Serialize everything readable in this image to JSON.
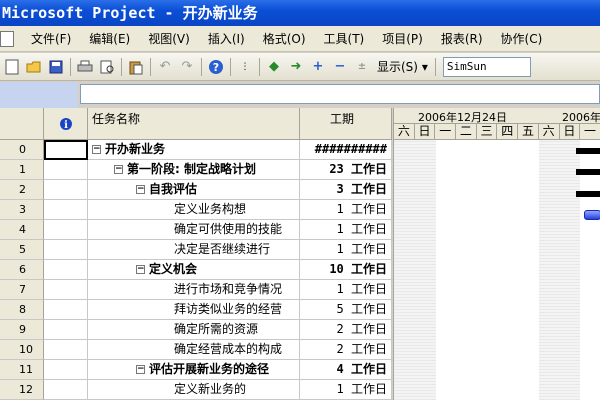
{
  "window": {
    "title": "Microsoft Project - 开办新业务"
  },
  "menu": [
    "文件(F)",
    "编辑(E)",
    "视图(V)",
    "插入(I)",
    "格式(O)",
    "工具(T)",
    "项目(P)",
    "报表(R)",
    "协作(C)"
  ],
  "toolbar": {
    "show_label": "显示(S)",
    "show_arrow": "▾",
    "font": "SimSun"
  },
  "grid": {
    "headers": {
      "info": "i",
      "name": "任务名称",
      "duration": "工期"
    },
    "rows": [
      {
        "id": "0",
        "name": "开办新业务",
        "duration": "##########",
        "bold": true,
        "indent": 0,
        "toggle": "−"
      },
      {
        "id": "1",
        "name": "第一阶段: 制定战略计划",
        "duration": "23 工作日",
        "bold": true,
        "indent": 1,
        "toggle": "−"
      },
      {
        "id": "2",
        "name": "自我评估",
        "duration": "3 工作日",
        "bold": true,
        "indent": 2,
        "toggle": "−"
      },
      {
        "id": "3",
        "name": "定义业务构想",
        "duration": "1 工作日",
        "bold": false,
        "indent": 3,
        "toggle": ""
      },
      {
        "id": "4",
        "name": "确定可供使用的技能",
        "duration": "1 工作日",
        "bold": false,
        "indent": 3,
        "toggle": ""
      },
      {
        "id": "5",
        "name": "决定是否继续进行",
        "duration": "1 工作日",
        "bold": false,
        "indent": 3,
        "toggle": ""
      },
      {
        "id": "6",
        "name": "定义机会",
        "duration": "10 工作日",
        "bold": true,
        "indent": 2,
        "toggle": "−"
      },
      {
        "id": "7",
        "name": "进行市场和竞争情况",
        "duration": "1 工作日",
        "bold": false,
        "indent": 3,
        "toggle": ""
      },
      {
        "id": "8",
        "name": "拜访类似业务的经营",
        "duration": "5 工作日",
        "bold": false,
        "indent": 3,
        "toggle": ""
      },
      {
        "id": "9",
        "name": "确定所需的资源",
        "duration": "2 工作日",
        "bold": false,
        "indent": 3,
        "toggle": ""
      },
      {
        "id": "10",
        "name": "确定经营成本的构成",
        "duration": "2 工作日",
        "bold": false,
        "indent": 3,
        "toggle": ""
      },
      {
        "id": "11",
        "name": "评估开展新业务的途径",
        "duration": "4 工作日",
        "bold": true,
        "indent": 2,
        "toggle": "−"
      },
      {
        "id": "12",
        "name": "定义新业务的",
        "duration": "1 工作日",
        "bold": false,
        "indent": 3,
        "toggle": ""
      }
    ]
  },
  "gantt": {
    "week1_label": "2006年12月24日",
    "week2_label": "2006年",
    "days": [
      "六",
      "日",
      "一",
      "二",
      "三",
      "四",
      "五",
      "六",
      "日",
      "一"
    ]
  }
}
